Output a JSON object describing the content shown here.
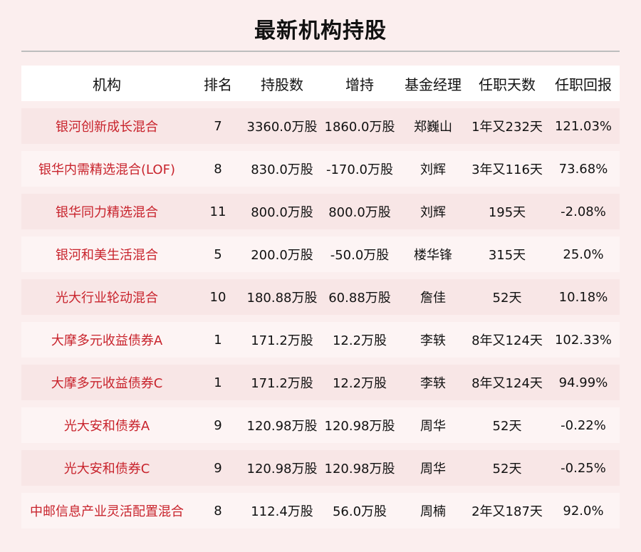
{
  "title": "最新机构持股",
  "headers": [
    "机构",
    "排名",
    "持股数",
    "增持",
    "基金经理",
    "任职天数",
    "任职回报"
  ],
  "rows": [
    [
      "银河创新成长混合",
      "7",
      "3360.0万股",
      "1860.0万股",
      "郑巍山",
      "1年又232天",
      "121.03%"
    ],
    [
      "银华内需精选混合(LOF)",
      "8",
      "830.0万股",
      "-170.0万股",
      "刘辉",
      "3年又116天",
      "73.68%"
    ],
    [
      "银华同力精选混合",
      "11",
      "800.0万股",
      "800.0万股",
      "刘辉",
      "195天",
      "-2.08%"
    ],
    [
      "银河和美生活混合",
      "5",
      "200.0万股",
      "-50.0万股",
      "楼华锋",
      "315天",
      "25.0%"
    ],
    [
      "光大行业轮动混合",
      "10",
      "180.88万股",
      "60.88万股",
      "詹佳",
      "52天",
      "10.18%"
    ],
    [
      "大摩多元收益债券A",
      "1",
      "171.2万股",
      "12.2万股",
      "李轶",
      "8年又124天",
      "102.33%"
    ],
    [
      "大摩多元收益债券C",
      "1",
      "171.2万股",
      "12.2万股",
      "李轶",
      "8年又124天",
      "94.99%"
    ],
    [
      "光大安和债券A",
      "9",
      "120.98万股",
      "120.98万股",
      "周华",
      "52天",
      "-0.22%"
    ],
    [
      "光大安和债券C",
      "9",
      "120.98万股",
      "120.98万股",
      "周华",
      "52天",
      "-0.25%"
    ],
    [
      "中邮信息产业灵活配置混合",
      "8",
      "112.4万股",
      "56.0万股",
      "周楠",
      "2年又187天",
      "92.0%"
    ]
  ]
}
